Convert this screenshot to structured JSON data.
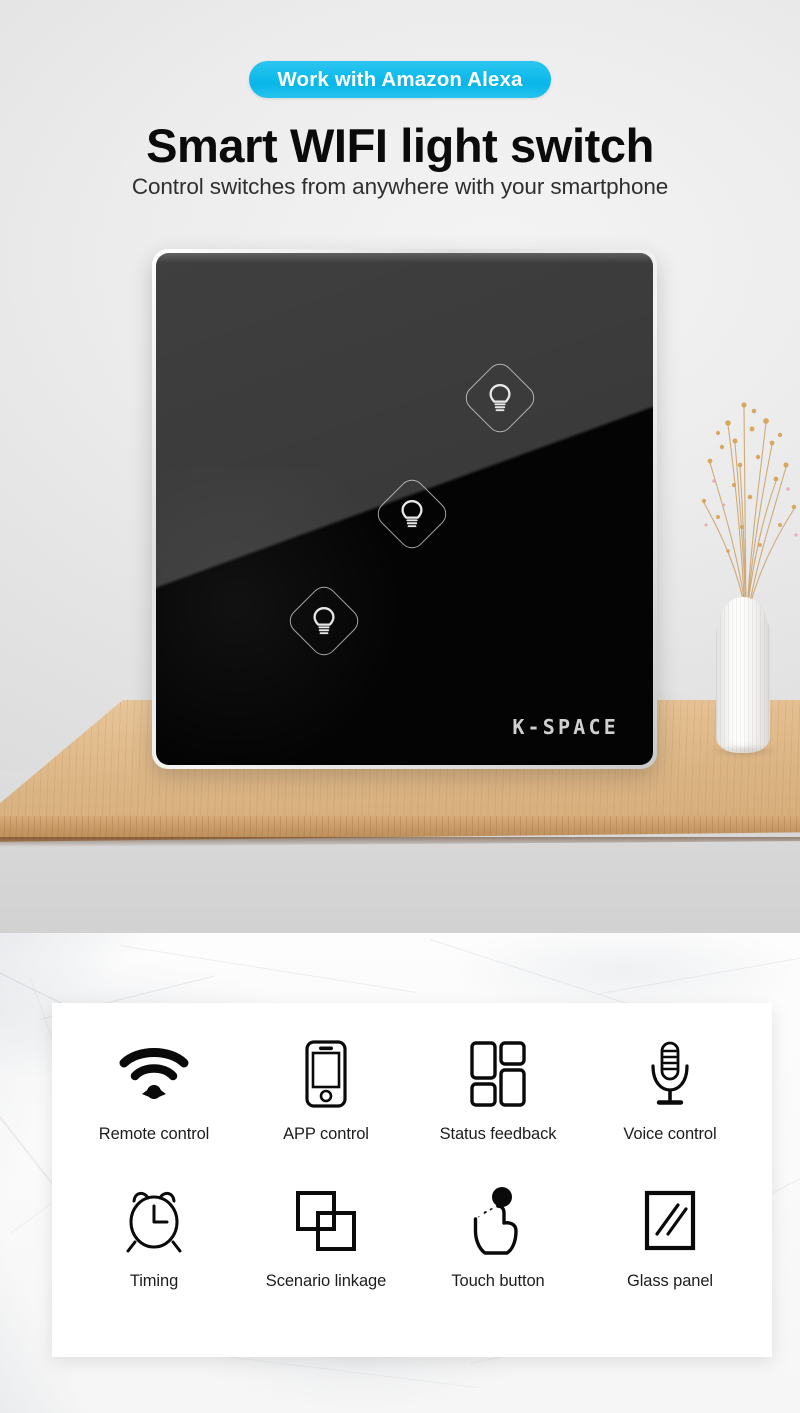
{
  "hero": {
    "badge": {
      "label": "Work with Amazon Alexa",
      "bg_color": "#14bdec",
      "text_color": "#ffffff"
    },
    "title": "Smart WIFI light switch",
    "subtitle": "Control switches from anywhere with your smartphone",
    "background_color": "#ececec",
    "product": {
      "brand": "K-SPACE",
      "panel_color": "#040404",
      "bezel_color": "#e0e0e0",
      "buttons": [
        {
          "name": "touch-key-1",
          "icon": "light-bulb-icon",
          "position": "top-right"
        },
        {
          "name": "touch-key-2",
          "icon": "light-bulb-icon",
          "position": "middle"
        },
        {
          "name": "touch-key-3",
          "icon": "light-bulb-icon",
          "position": "bottom-left"
        }
      ]
    },
    "scene": {
      "table_color": "#e2bd8e",
      "table_edge_color": "#c89a66",
      "vase_color": "#ffffff",
      "flower_color": "#d8a354"
    }
  },
  "features_section": {
    "card_color": "#ffffff",
    "background_color": "#fafafa",
    "items": [
      {
        "label": "Remote control",
        "icon": "wifi-icon"
      },
      {
        "label": "APP control",
        "icon": "smartphone-icon"
      },
      {
        "label": "Status feedback",
        "icon": "grid-blocks-icon"
      },
      {
        "label": "Voice control",
        "icon": "microphone-icon"
      },
      {
        "label": "Timing",
        "icon": "alarm-clock-icon"
      },
      {
        "label": "Scenario linkage",
        "icon": "overlapping-squares-icon"
      },
      {
        "label": "Touch button",
        "icon": "pointing-hand-touch-icon"
      },
      {
        "label": "Glass panel",
        "icon": "glass-panel-icon"
      }
    ]
  }
}
